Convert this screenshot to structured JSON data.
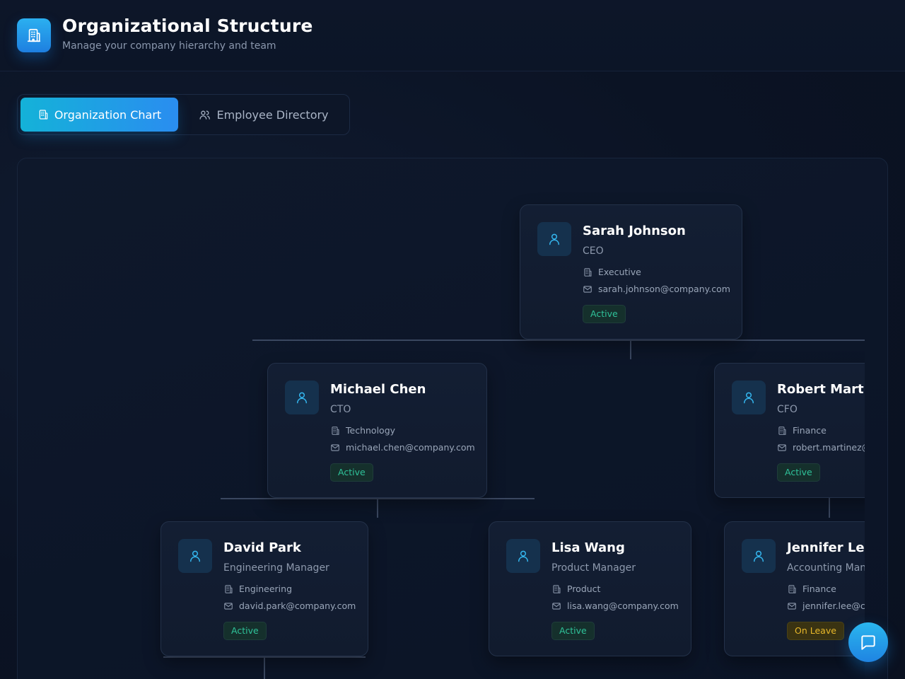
{
  "header": {
    "title": "Organizational Structure",
    "subtitle": "Manage your company hierarchy and team",
    "logo_icon": "building-icon"
  },
  "tabs": [
    {
      "label": "Organization Chart",
      "icon": "building-icon",
      "active": true
    },
    {
      "label": "Employee Directory",
      "icon": "users-icon",
      "active": false
    }
  ],
  "org_chart": {
    "employees": [
      {
        "name": "Sarah Johnson",
        "role": "CEO",
        "department": "Executive",
        "email": "sarah.johnson@company.com",
        "status": "Active",
        "reports_to": null
      },
      {
        "name": "Michael Chen",
        "role": "CTO",
        "department": "Technology",
        "email": "michael.chen@company.com",
        "status": "Active",
        "reports_to": "Sarah Johnson"
      },
      {
        "name": "Robert Martinez",
        "role": "CFO",
        "department": "Finance",
        "email": "robert.martinez@company.com",
        "status": "Active",
        "reports_to": "Sarah Johnson"
      },
      {
        "name": "David Park",
        "role": "Engineering Manager",
        "department": "Engineering",
        "email": "david.park@company.com",
        "status": "Active",
        "reports_to": "Michael Chen"
      },
      {
        "name": "Lisa Wang",
        "role": "Product Manager",
        "department": "Product",
        "email": "lisa.wang@company.com",
        "status": "Active",
        "reports_to": "Michael Chen"
      },
      {
        "name": "Jennifer Lee",
        "role": "Accounting Manager",
        "department": "Finance",
        "email": "jennifer.lee@company.com",
        "status": "On Leave",
        "reports_to": "Robert Martinez"
      }
    ]
  },
  "colors": {
    "accent": "#2a8df0",
    "status_active": "#2fc39a",
    "status_on_leave": "#e8b82a"
  },
  "chat_button_icon": "chat-icon"
}
